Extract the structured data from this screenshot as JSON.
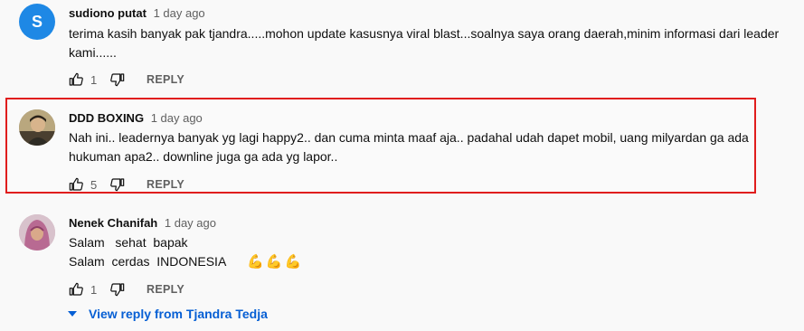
{
  "comments": [
    {
      "avatar_letter": "S",
      "author": "sudiono putat",
      "time": "1 day ago",
      "text_lines": [
        "terima kasih banyak pak tjandra.....mohon update kasusnya viral blast...soalnya saya orang daerah,minim informasi dari leader",
        "kami......"
      ],
      "likes": "1",
      "reply_label": "REPLY"
    },
    {
      "author": "DDD BOXING",
      "time": "1 day ago",
      "text_lines": [
        "Nah ini.. leadernya banyak yg lagi happy2.. dan cuma minta maaf aja.. padahal udah dapet mobil, uang milyardan ga ada",
        "hukuman apa2.. downline juga ga ada yg lapor.."
      ],
      "likes": "5",
      "reply_label": "REPLY"
    },
    {
      "author": "Nenek Chanifah",
      "time": "1 day ago",
      "text_lines": [
        "Salam   sehat  bapak",
        "Salam  cerdas  INDONESIA"
      ],
      "emojis": [
        "💪",
        "💪",
        "💪"
      ],
      "likes": "1",
      "reply_label": "REPLY"
    }
  ],
  "view_replies_label": "View reply from Tjandra Tedja",
  "colors": {
    "accent": "#065fd4",
    "highlight_border": "#e01d1d",
    "avatar_bg": "#1e88e5"
  },
  "icons": [
    "thumb-up-icon",
    "thumb-down-icon",
    "caret-down-icon"
  ]
}
